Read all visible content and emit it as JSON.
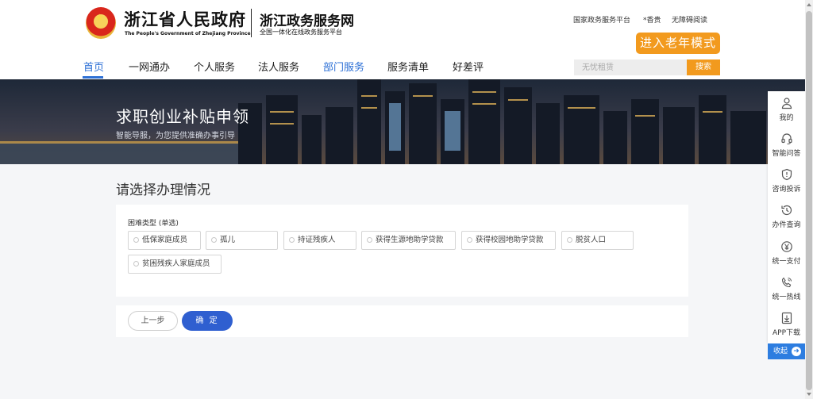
{
  "header": {
    "gov_title": "浙江省人民政府",
    "gov_subtitle": "The People's Government of Zhejiang Province",
    "service_title": "浙江政务服务网",
    "service_subtitle": "全国一体化在线政务服务平台",
    "top_links": [
      "国家政务服务平台",
      "*香贵",
      "无障碍阅读"
    ],
    "elder_mode": "进入老年模式",
    "nav": [
      "首页",
      "一网通办",
      "个人服务",
      "法人服务",
      "部门服务",
      "服务清单",
      "好差评"
    ],
    "search": {
      "placeholder": "无忧租赁",
      "button": "搜索"
    }
  },
  "banner": {
    "title": "求职创业补贴申领",
    "subtitle": "智能导服，为您提供准确办事引导"
  },
  "main": {
    "section_title": "请选择办理情况",
    "question_label": "困难类型 (单选)",
    "options": [
      "低保家庭成员",
      "孤儿",
      "持证残疾人",
      "获得生源地助学贷款",
      "获得校园地助学贷款",
      "脱贫人口",
      "贫困残疾人家庭成员"
    ],
    "prev_label": "上一步",
    "ok_label": "确 定"
  },
  "side_panel": {
    "items": [
      {
        "label": "我的",
        "icon": "user-icon"
      },
      {
        "label": "智能问答",
        "icon": "headset-icon"
      },
      {
        "label": "咨询投诉",
        "icon": "shield-icon"
      },
      {
        "label": "办件查询",
        "icon": "history-icon"
      },
      {
        "label": "统一支付",
        "icon": "yen-icon"
      },
      {
        "label": "统一热线",
        "icon": "phone-icon"
      },
      {
        "label": "APP下载",
        "icon": "download-icon"
      }
    ],
    "collapse": "收起"
  },
  "colors": {
    "accent_blue": "#2d70d6",
    "accent_orange": "#f29a1e",
    "confirm_blue": "#2f5fd0"
  }
}
